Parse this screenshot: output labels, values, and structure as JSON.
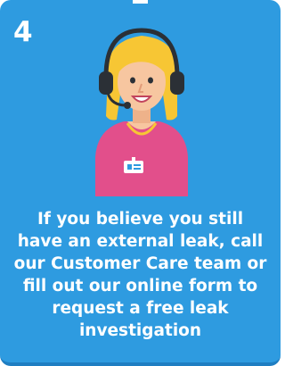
{
  "card": {
    "step_number": "4",
    "description": "If you believe you still have an external leak, call our Customer Care team or fill out our online form to request a free leak investigation"
  },
  "colors": {
    "card_background": "#2e9be0",
    "text": "#ffffff",
    "hair": "#f7c634",
    "skin": "#f7c6a0",
    "shirt": "#e24f8b",
    "headset": "#2b3036"
  },
  "icons": {
    "illustration": "customer-service-agent-with-headset"
  }
}
